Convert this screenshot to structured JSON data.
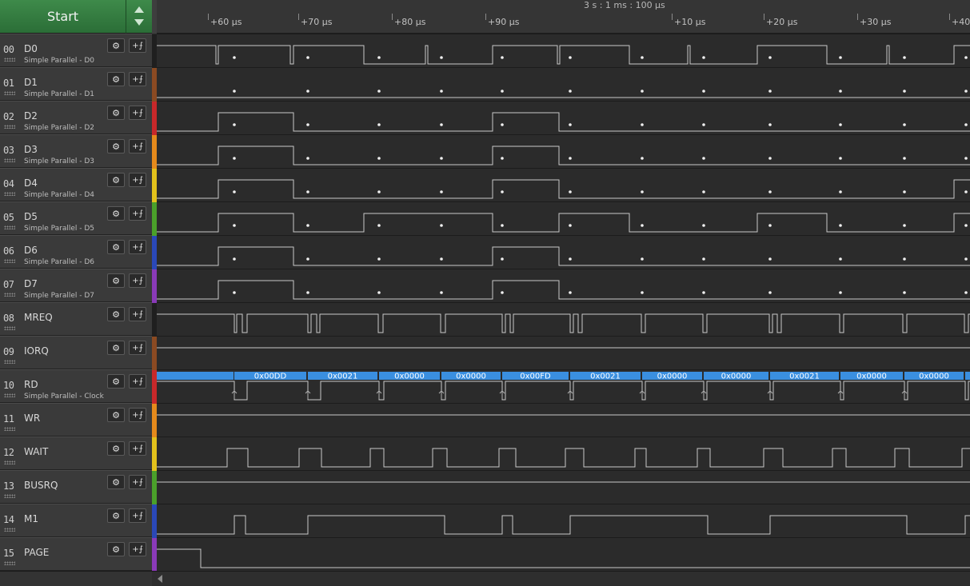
{
  "start": {
    "label": "Start"
  },
  "ruler": {
    "scale": "3 s : 1 ms : 100 µs",
    "ticks": [
      "+60 µs",
      "+70 µs",
      "+80 µs",
      "+90 µs",
      "+10 µs",
      "+20 µs",
      "+30 µs",
      "+40"
    ]
  },
  "channels": [
    {
      "num": "00",
      "name": "D0",
      "sub": "Simple Parallel - D0",
      "color": "#1f1f1f"
    },
    {
      "num": "01",
      "name": "D1",
      "sub": "Simple Parallel - D1",
      "color": "#8b4a22"
    },
    {
      "num": "02",
      "name": "D2",
      "sub": "Simple Parallel - D2",
      "color": "#c8282a"
    },
    {
      "num": "03",
      "name": "D3",
      "sub": "Simple Parallel - D3",
      "color": "#e58a1c"
    },
    {
      "num": "04",
      "name": "D4",
      "sub": "Simple Parallel - D4",
      "color": "#e3c21c"
    },
    {
      "num": "05",
      "name": "D5",
      "sub": "Simple Parallel - D5",
      "color": "#4aa02a"
    },
    {
      "num": "06",
      "name": "D6",
      "sub": "Simple Parallel - D6",
      "color": "#2a48b8"
    },
    {
      "num": "07",
      "name": "D7",
      "sub": "Simple Parallel - D7",
      "color": "#8a3ab8"
    },
    {
      "num": "08",
      "name": "MREQ",
      "sub": "",
      "color": "#1f1f1f"
    },
    {
      "num": "09",
      "name": "IORQ",
      "sub": "",
      "color": "#8b4a22"
    },
    {
      "num": "10",
      "name": "RD",
      "sub": "Simple Parallel - Clock",
      "color": "#c8282a"
    },
    {
      "num": "11",
      "name": "WR",
      "sub": "",
      "color": "#e58a1c"
    },
    {
      "num": "12",
      "name": "WAIT",
      "sub": "",
      "color": "#e3c21c"
    },
    {
      "num": "13",
      "name": "BUSRQ",
      "sub": "",
      "color": "#4aa02a"
    },
    {
      "num": "14",
      "name": "M1",
      "sub": "",
      "color": "#2a48b8"
    },
    {
      "num": "15",
      "name": "PAGE",
      "sub": "",
      "color": "#8a3ab8"
    }
  ],
  "bus_values": [
    "0x00DD",
    "0x0021",
    "0x0000",
    "0x0000",
    "0x00FD",
    "0x0021",
    "0x0000",
    "0x0000",
    "0x0021",
    "0x0000",
    "0x0000"
  ],
  "colors": {
    "bus": "#3a8fe0",
    "wave": "#c8c8c8",
    "background": "#2b2b2b"
  },
  "icons": {
    "settings": "gear-icon",
    "add_trigger": "add-trigger-icon"
  }
}
